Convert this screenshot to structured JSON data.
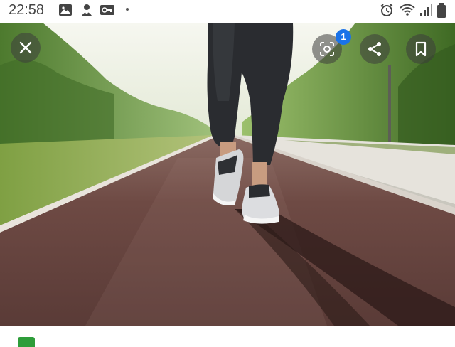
{
  "status_bar": {
    "time": "22:58",
    "left_icons": [
      "image-icon",
      "notification-icon",
      "vpn-key-icon",
      "dot-icon"
    ],
    "right_icons": [
      "alarm-icon",
      "wifi-icon",
      "signal-icon",
      "battery-icon"
    ]
  },
  "viewer": {
    "close_icon": "close-icon",
    "lens_icon": "google-lens-icon",
    "lens_badge": "1",
    "share_icon": "share-icon",
    "bookmark_icon": "bookmark-icon"
  },
  "image": {
    "subject": "runner-on-track-photo"
  },
  "source": {
    "favicon_color": "#2e9d3a",
    "name": ""
  },
  "colors": {
    "accent": "#1a73e8",
    "overlay_button": "#3c3c3c"
  }
}
